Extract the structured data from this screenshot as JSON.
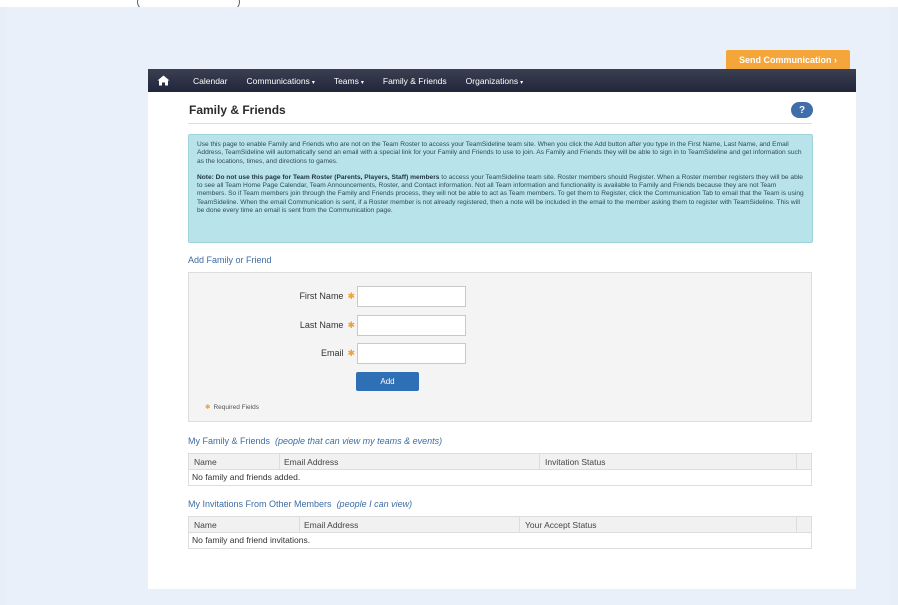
{
  "send_communication": "Send Communication ›",
  "nav": {
    "items": [
      {
        "label": "Calendar",
        "caret": ""
      },
      {
        "label": "Communications",
        "caret": "▾"
      },
      {
        "label": "Teams",
        "caret": "▾"
      },
      {
        "label": "Family & Friends",
        "caret": ""
      },
      {
        "label": "Organizations",
        "caret": "▾"
      }
    ]
  },
  "page": {
    "title": "Family & Friends",
    "help": "?"
  },
  "info": {
    "para1": "Use this page to enable Family and Friends who are not on the Team Roster to access your TeamSideline team site. When you click the Add button after you type in the First Name, Last Name, and Email Address, TeamSideline will automatically send an email with a special link for your Family and Friends to use to join. As Family and Friends they will be able to sign in to TeamSideline and get information such as the locations, times, and directions to games.",
    "note_bold": "Note: Do not use this page for Team Roster (Parents, Players, Staff) members",
    "note_rest": " to access your TeamSideline team site. Roster members should Register. When a Roster member registers they will be able to see all Team Home Page Calendar, Team Announcements, Roster, and Contact information. Not all Team information and functionality is available to Family and Friends because they are not Team members. So if Team members join through the Family and Friends process, they will not be able to act as Team members. To get them to Register, click the Communication Tab to email that the Team is using TeamSideline. When the email Communication is sent, if a Roster member is not already registered, then a note will be included in the email to the member asking them to register with TeamSideline. This will be done every time an email is sent from the Communication page."
  },
  "add_form": {
    "heading": "Add Family or Friend",
    "first_name_label": "First Name",
    "last_name_label": "Last Name",
    "email_label": "Email",
    "star": "✱",
    "first_name_value": "",
    "last_name_value": "",
    "email_value": "",
    "add_button": "Add",
    "required_note": "Required Fields"
  },
  "my_family": {
    "heading": "My Family & Friends",
    "heading_note": "(people that can view my teams & events)",
    "columns": [
      "Name",
      "Email Address",
      "Invitation Status"
    ],
    "empty": "No family and friends added."
  },
  "my_invitations": {
    "heading": "My Invitations From Other Members",
    "heading_note": "(people I can view)",
    "columns": [
      "Name",
      "Email Address",
      "Your Accept Status"
    ],
    "empty": "No family and friend invitations."
  }
}
